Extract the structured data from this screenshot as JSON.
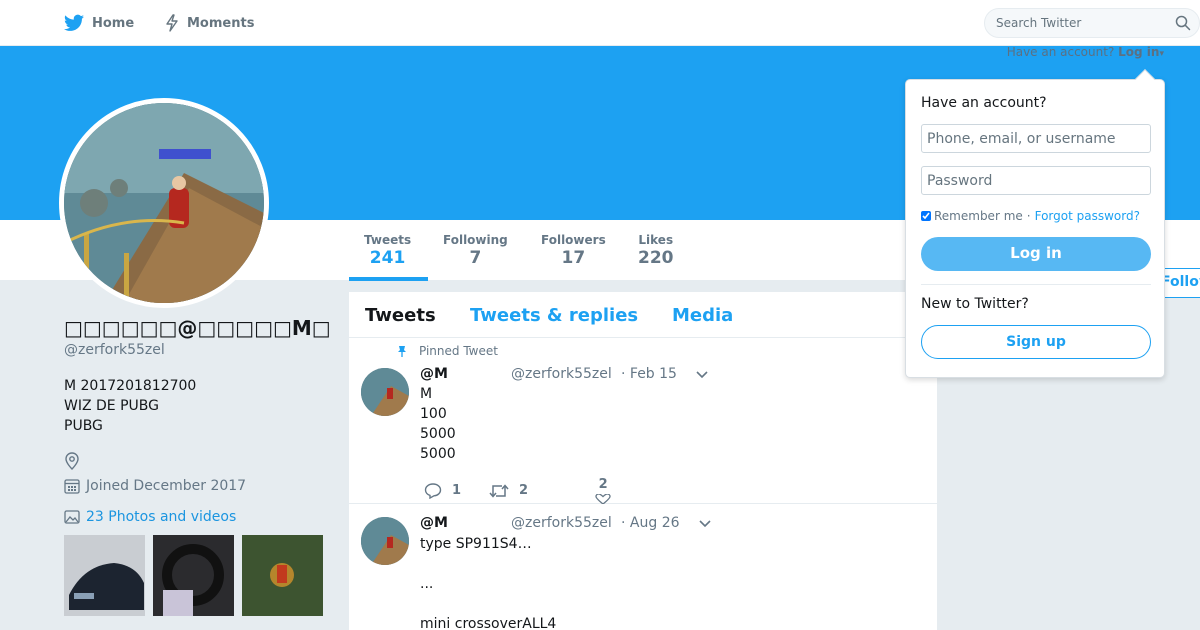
{
  "nav": {
    "home_label": "Home",
    "moments_label": "Moments",
    "search_placeholder": "Search Twitter"
  },
  "header": {
    "have_account_text": "Have an account?",
    "login_link": "Log in"
  },
  "profile": {
    "display_name": "□□□□□□@□□□□□M□",
    "screen_name": "@zerfork55zel",
    "bio_lines": [
      "M  2017201812700",
      "WIZ DE   PUBG",
      "PUBG"
    ],
    "joined": "Joined December 2017",
    "photos_label": "23 Photos and videos",
    "follow_label": "Follow"
  },
  "stats": [
    {
      "label": "Tweets",
      "value": "241"
    },
    {
      "label": "Following",
      "value": "7"
    },
    {
      "label": "Followers",
      "value": "17"
    },
    {
      "label": "Likes",
      "value": "220"
    }
  ],
  "tabs": [
    "Tweets",
    "Tweets & replies",
    "Media"
  ],
  "tweets": [
    {
      "pinned_label": "Pinned Tweet",
      "name": "@M",
      "handle": "@zerfork55zel",
      "date": "· Feb 15",
      "body_lines": [
        "M",
        "100",
        "5000",
        "5000"
      ],
      "replies": "1",
      "retweets": "2",
      "likes": "2"
    },
    {
      "name": "@M",
      "handle": "@zerfork55zel",
      "date": "· Aug 26",
      "body_lines": [
        "type SP911S4…",
        "",
        "...",
        "",
        "mini crossoverALL4"
      ]
    }
  ],
  "login_dropdown": {
    "title": "Have an account?",
    "username_placeholder": "Phone, email, or username",
    "password_placeholder": "Password",
    "remember_label": "Remember me",
    "separator": "·",
    "forgot_label": "Forgot password?",
    "login_button": "Log in",
    "new_label": "New to Twitter?",
    "signup_button": "Sign up"
  },
  "colors": {
    "brand": "#1da1f2",
    "banner": "#1da1f2",
    "background": "#e6ecf0"
  },
  "icons": [
    "twitter-bird-icon",
    "lightning-icon",
    "search-icon",
    "pin-icon",
    "reply-icon",
    "retweet-icon",
    "heart-icon",
    "location-icon",
    "calendar-icon",
    "photo-icon",
    "chevron-down-icon"
  ]
}
